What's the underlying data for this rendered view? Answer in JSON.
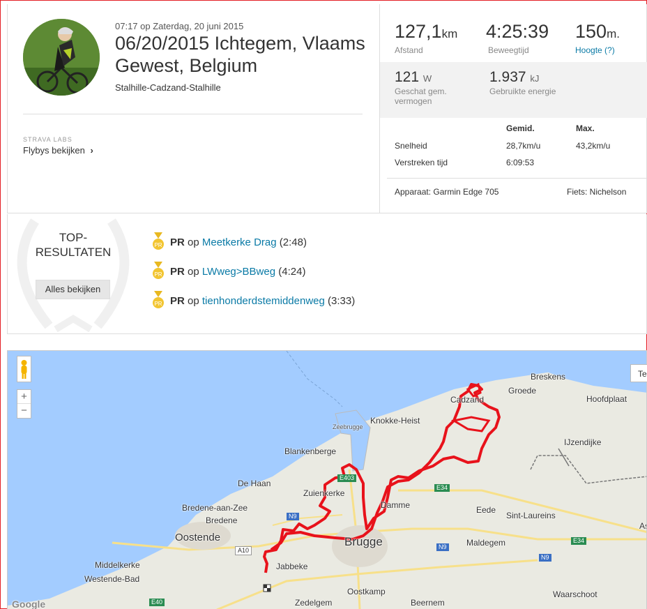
{
  "activity": {
    "datetime": "07:17 op Zaterdag, 20 juni 2015",
    "title": "06/20/2015 Ichtegem, Vlaams Gewest, Belgium",
    "description": "Stalhille-Cadzand-Stalhille",
    "labs_label": "STRAVA LABS",
    "flybys": "Flybys bekijken",
    "flybys_chevron": "›"
  },
  "stats": {
    "distance_value": "127,1",
    "distance_unit": "km",
    "distance_label": "Afstand",
    "moving_value": "4:25:39",
    "moving_label": "Beweegtijd",
    "elevation_value": "150",
    "elevation_unit": "m.",
    "elevation_label": "Hoogte (?)",
    "power_value": "121",
    "power_unit": "W",
    "power_label": "Geschat gem. vermogen",
    "energy_value": "1.937",
    "energy_unit": "kJ",
    "energy_label": "Gebruikte energie",
    "col_avg": "Gemid.",
    "col_max": "Max.",
    "speed_label": "Snelheid",
    "speed_avg": "28,7km/u",
    "speed_max": "43,2km/u",
    "elapsed_label": "Verstreken tijd",
    "elapsed_avg": "6:09:53",
    "device": "Apparaat: Garmin Edge 705",
    "bike": "Fiets: Nichelson"
  },
  "top_results": {
    "title": "TOP-RESULTATEN",
    "view_all": "Alles bekijken",
    "items": [
      {
        "badge": "PR",
        "prefix": "op",
        "segment": "Meetkerke Drag",
        "time": "(2:48)"
      },
      {
        "badge": "PR",
        "prefix": "op",
        "segment": "LWweg>BBweg",
        "time": "(4:24)"
      },
      {
        "badge": "PR",
        "prefix": "op",
        "segment": "tienhonderdstemiddenweg",
        "time": "(3:33)"
      }
    ]
  },
  "map": {
    "zoom_in": "+",
    "zoom_out": "−",
    "terrain_btn": "Te",
    "attribution": "Google",
    "places": [
      "Breskens",
      "Groede",
      "Hoofdplaat",
      "Cadzand",
      "Knokke-Heist",
      "Zeebrugge",
      "IJzendijke",
      "Blankenberge",
      "De Haan",
      "Zuienkerke",
      "Damme",
      "Bredene-aan-Zee",
      "Bredene",
      "Eede",
      "Sint-Laureins",
      "Oostende",
      "Brugge",
      "Maldegem",
      "Middelkerke",
      "Jabbeke",
      "Westende-Bad",
      "Oostkamp",
      "Waarschoot",
      "Zedelgem",
      "Beernem",
      "As"
    ],
    "roads": [
      "E403",
      "N9",
      "A10",
      "E34",
      "N9",
      "E34",
      "N9",
      "E40"
    ]
  },
  "colors": {
    "accent": "#fc4c02",
    "link": "#0a7aa6",
    "route": "#e8121b",
    "sea": "#a3ccff",
    "land": "#eaeae2"
  }
}
